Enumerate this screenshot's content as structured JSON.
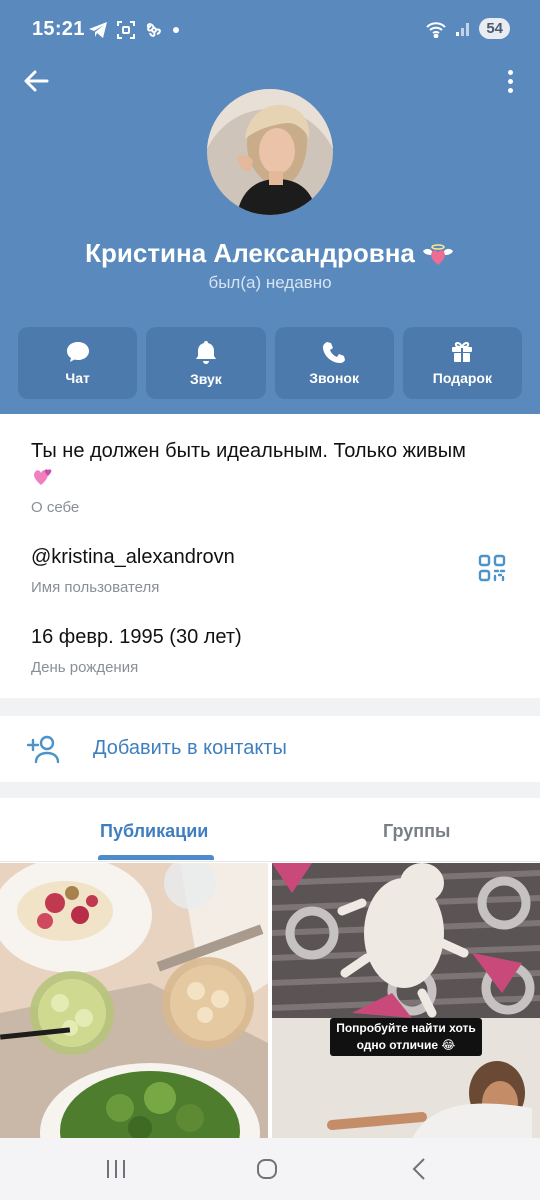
{
  "status_bar": {
    "time": "15:21",
    "battery": "54",
    "icons": [
      "telegram-icon",
      "screenshot-icon",
      "fan-icon",
      "dot-icon",
      "wifi-icon",
      "signal-icon"
    ]
  },
  "profile": {
    "name": "Кристина Александровна",
    "status": "был(а) недавно"
  },
  "actions": [
    {
      "label": "Чат",
      "icon": "chat-icon"
    },
    {
      "label": "Звук",
      "icon": "bell-icon"
    },
    {
      "label": "Звонок",
      "icon": "phone-icon"
    },
    {
      "label": "Подарок",
      "icon": "gift-icon"
    }
  ],
  "info": {
    "bio": {
      "value": "Ты не должен быть идеальным. Только живым",
      "label": "О себе"
    },
    "username": {
      "value": "@kristina_alexandrovn",
      "label": "Имя пользователя"
    },
    "birthday": {
      "value": "16 февр. 1995 (30 лет)",
      "label": "День рождения"
    }
  },
  "add_contact": {
    "label": "Добавить в контакты"
  },
  "tabs": [
    {
      "label": "Публикации",
      "active": true
    },
    {
      "label": "Группы",
      "active": false
    }
  ],
  "media": {
    "meme_caption": "Попробуйте найти хоть одно отличие 😂"
  },
  "colors": {
    "header": "#5a89bd",
    "action_button": "#4d7aac",
    "accent": "#3f7fbf"
  }
}
